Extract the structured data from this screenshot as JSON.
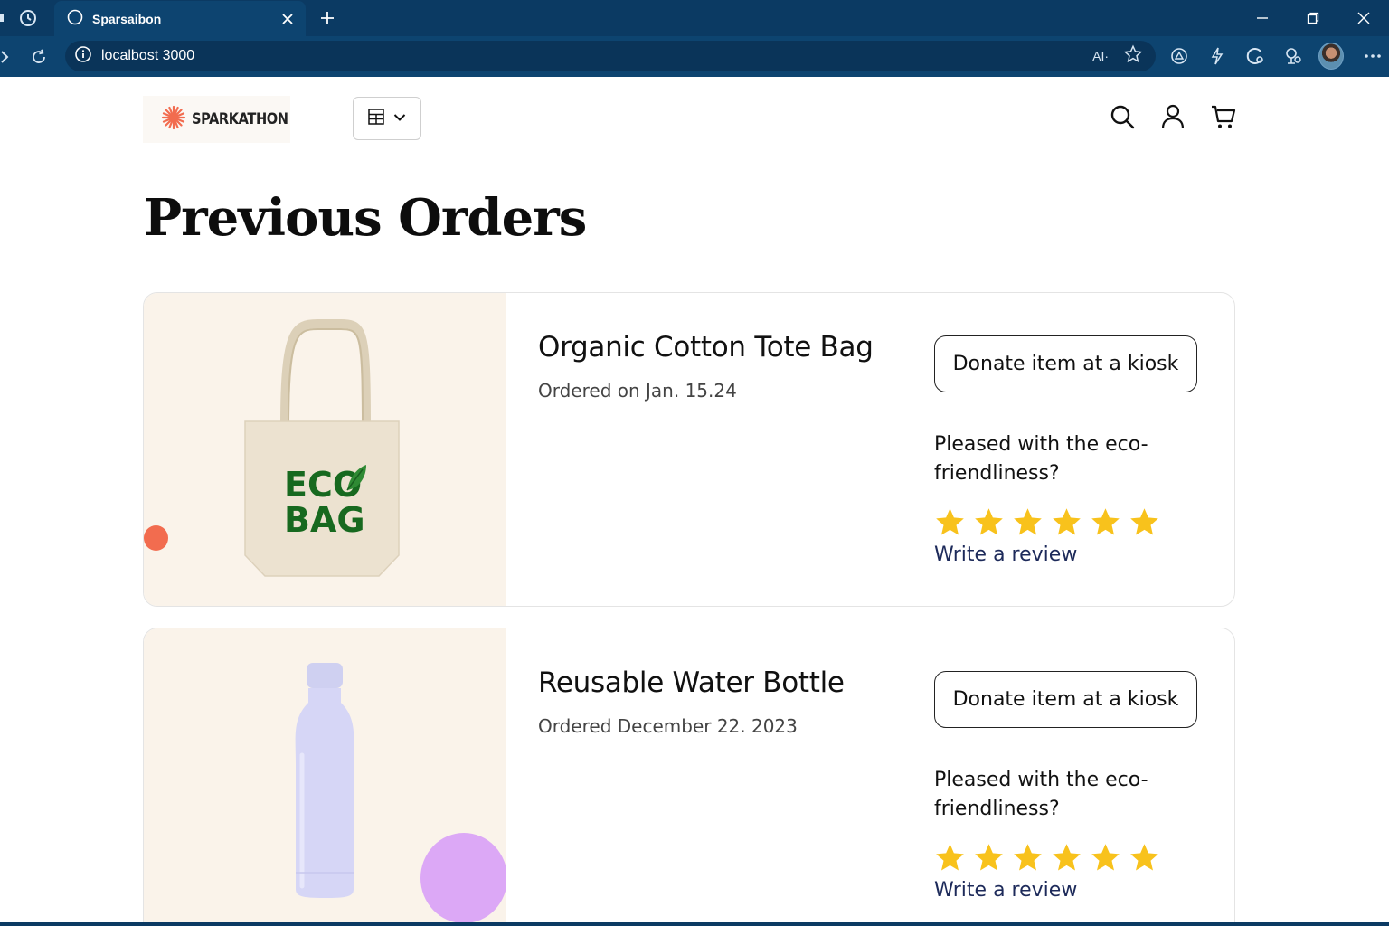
{
  "browser": {
    "tab_title": "Sparsaibon",
    "url": "localbost 3000",
    "ai_label": "AΙ·"
  },
  "site": {
    "logo_text": "SPARKATHON",
    "brand_color": "#f26c4f"
  },
  "page": {
    "title": "Previous Orders"
  },
  "orders": [
    {
      "name": "Organic Cotton Tote Bag",
      "date": "Ordered on Jan. 15.24",
      "donate_label": "Donate item at a kiosk",
      "eco_question": "Pleased with the eco-friendliness?",
      "rating": 6,
      "review_label": "Write a review",
      "image_text_line1": "ECO",
      "image_text_line2": "BAG"
    },
    {
      "name": "Reusable Water Bottle",
      "date": "Ordered December 22. 2023",
      "donate_label": "Donate item at a kiosk",
      "eco_question": "Pleased with the eco-friendliness?",
      "rating": 6,
      "review_label": "Write a review"
    }
  ],
  "colors": {
    "star": "#f8c21c",
    "browser_bg": "#0b3a63"
  }
}
